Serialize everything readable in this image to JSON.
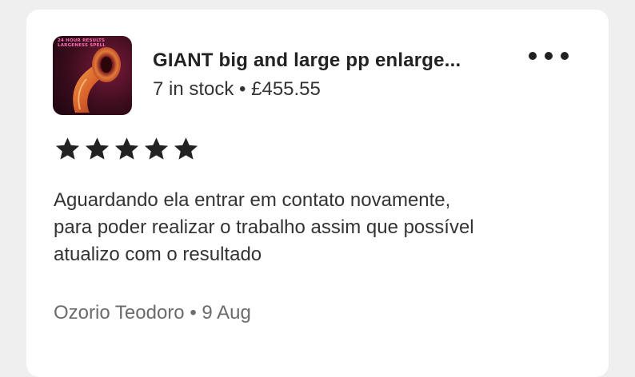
{
  "listing": {
    "thumbnail_icon": "product-thumbnail",
    "thumbnail_caption": "24 HOUR RESULTS LARGENESS SPELL",
    "title": "GIANT big and large pp enlarge...",
    "stock_and_price": "7 in stock • £455.55",
    "more_icon": "more-options-icon"
  },
  "review": {
    "rating": 5,
    "rating_max": 5,
    "text": "Aguardando ela entrar em contato novamente,\npara poder realizar o trabalho assim que possível\natualizo com o resultado",
    "reviewer": "Ozorio Teodoro",
    "date": "9 Aug",
    "footer": "Ozorio Teodoro • 9 Aug"
  },
  "colors": {
    "background": "#efefef",
    "card": "#ffffff",
    "title": "#222222",
    "body_text": "#333333",
    "muted_text": "#6b6b6b",
    "star": "#222222"
  }
}
